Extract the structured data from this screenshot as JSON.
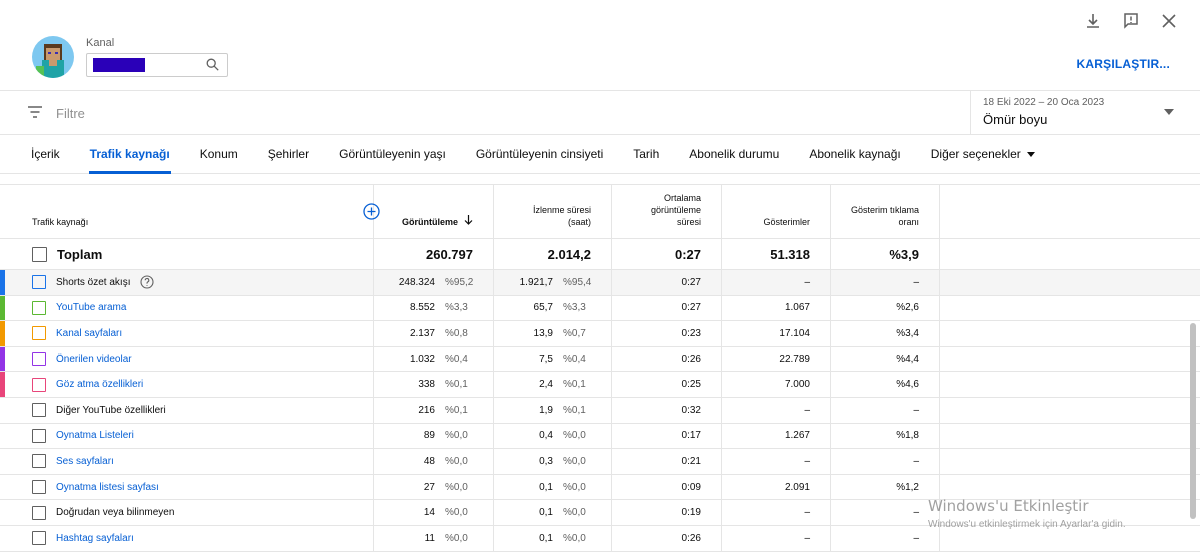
{
  "header": {
    "channel_label": "Kanal",
    "compare_button": "KARŞILAŞTIR...",
    "accent_color": "#065fd4"
  },
  "filter": {
    "placeholder": "Filtre",
    "date_range": "18 Eki 2022 – 20 Oca 2023",
    "date_label": "Ömür boyu"
  },
  "tabs": [
    {
      "label": "İçerik",
      "active": false
    },
    {
      "label": "Trafik kaynağı",
      "active": true
    },
    {
      "label": "Konum",
      "active": false
    },
    {
      "label": "Şehirler",
      "active": false
    },
    {
      "label": "Görüntüleyenin yaşı",
      "active": false
    },
    {
      "label": "Görüntüleyenin cinsiyeti",
      "active": false
    },
    {
      "label": "Tarih",
      "active": false
    },
    {
      "label": "Abonelik durumu",
      "active": false
    },
    {
      "label": "Abonelik kaynağı",
      "active": false
    },
    {
      "label": "Diğer seçenekler",
      "active": false
    }
  ],
  "table": {
    "columns": {
      "name": "Trafik kaynağı",
      "views": "Görüntüleme",
      "watch": "İzlenme süresi (saat)",
      "avg": "Ortalama görüntüleme süresi",
      "impressions": "Gösterimler",
      "ctr": "Gösterim tıklama oranı"
    },
    "total": {
      "label": "Toplam",
      "views": "260.797",
      "watch": "2.014,2",
      "avg": "0:27",
      "impressions": "51.318",
      "ctr": "%3,9"
    },
    "rows": [
      {
        "name": "Shorts özet akışı",
        "views": "248.324",
        "views_pct": "%95,2",
        "watch": "1.921,7",
        "watch_pct": "%95,4",
        "avg": "0:27",
        "impressions": "–",
        "ctr": "–"
      },
      {
        "name": "YouTube arama",
        "views": "8.552",
        "views_pct": "%3,3",
        "watch": "65,7",
        "watch_pct": "%3,3",
        "avg": "0:27",
        "impressions": "1.067",
        "ctr": "%2,6"
      },
      {
        "name": "Kanal sayfaları",
        "views": "2.137",
        "views_pct": "%0,8",
        "watch": "13,9",
        "watch_pct": "%0,7",
        "avg": "0:23",
        "impressions": "17.104",
        "ctr": "%3,4"
      },
      {
        "name": "Önerilen videolar",
        "views": "1.032",
        "views_pct": "%0,4",
        "watch": "7,5",
        "watch_pct": "%0,4",
        "avg": "0:26",
        "impressions": "22.789",
        "ctr": "%4,4"
      },
      {
        "name": "Göz atma özellikleri",
        "views": "338",
        "views_pct": "%0,1",
        "watch": "2,4",
        "watch_pct": "%0,1",
        "avg": "0:25",
        "impressions": "7.000",
        "ctr": "%4,6"
      },
      {
        "name": "Diğer YouTube özellikleri",
        "views": "216",
        "views_pct": "%0,1",
        "watch": "1,9",
        "watch_pct": "%0,1",
        "avg": "0:32",
        "impressions": "–",
        "ctr": "–"
      },
      {
        "name": "Oynatma Listeleri",
        "views": "89",
        "views_pct": "%0,0",
        "watch": "0,4",
        "watch_pct": "%0,0",
        "avg": "0:17",
        "impressions": "1.267",
        "ctr": "%1,8"
      },
      {
        "name": "Ses sayfaları",
        "views": "48",
        "views_pct": "%0,0",
        "watch": "0,3",
        "watch_pct": "%0,0",
        "avg": "0:21",
        "impressions": "–",
        "ctr": "–"
      },
      {
        "name": "Oynatma listesi sayfası",
        "views": "27",
        "views_pct": "%0,0",
        "watch": "0,1",
        "watch_pct": "%0,0",
        "avg": "0:09",
        "impressions": "2.091",
        "ctr": "%1,2"
      },
      {
        "name": "Doğrudan veya bilinmeyen",
        "views": "14",
        "views_pct": "%0,0",
        "watch": "0,1",
        "watch_pct": "%0,0",
        "avg": "0:19",
        "impressions": "–",
        "ctr": "–"
      },
      {
        "name": "Hashtag sayfaları",
        "views": "11",
        "views_pct": "%0,0",
        "watch": "0,1",
        "watch_pct": "%0,0",
        "avg": "0:26",
        "impressions": "–",
        "ctr": "–"
      }
    ]
  },
  "watermark": {
    "title": "Windows'u Etkinleştir",
    "subtitle": "Windows'u etkinleştirmek için Ayarlar'a gidin."
  }
}
